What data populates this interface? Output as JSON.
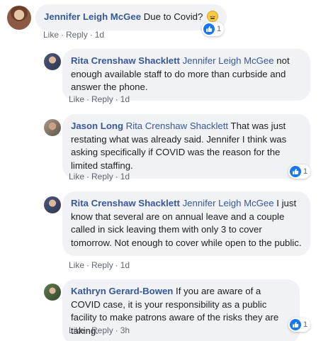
{
  "comments": [
    {
      "author": "Jennifer Leigh McGee",
      "mention": "",
      "text": "Due to Covid?",
      "emoji": "grimace-emoji",
      "actions": {
        "like": "Like",
        "reply": "Reply",
        "time": "1d",
        "dot": "·"
      },
      "reactions": {
        "count": "1",
        "icon": "like-icon"
      }
    },
    {
      "author": "Rita Crenshaw Shacklett",
      "mention": "Jennifer Leigh McGee",
      "text": "not enough available staff to do more than curbside and answer the phone.",
      "actions": {
        "like": "Like",
        "reply": "Reply",
        "time": "1d",
        "dot": "·"
      }
    },
    {
      "author": "Jason Long",
      "mention": "Rita Crenshaw Shacklett",
      "text": "That was just restating what was already said. Jennifer I think was asking specifically if COVID was the reason for the limited staffing.",
      "actions": {
        "like": "Like",
        "reply": "Reply",
        "time": "1d",
        "dot": "·"
      },
      "reactions": {
        "count": "1",
        "icon": "like-icon"
      }
    },
    {
      "author": "Rita Crenshaw Shacklett",
      "mention": "Jennifer Leigh McGee",
      "text": "I just know that several are on annual leave and a couple called in sick leaving them with only 3 to cover tomorrow. Not enough to cover while open to the public.",
      "actions": {
        "like": "Like",
        "reply": "Reply",
        "time": "1d",
        "dot": "·"
      }
    },
    {
      "author": "Kathryn Gerard-Bowen",
      "mention": "",
      "text": "If you are aware of a COVID case, it is your responsibility as a public facility to make patrons aware of the risks they are taking.",
      "actions": {
        "like": "Like",
        "reply": "Reply",
        "time": "3h",
        "dot": "·"
      },
      "reactions": {
        "count": "1",
        "icon": "like-icon"
      }
    }
  ],
  "colors": {
    "author": "#385898",
    "bubble": "#f0f2f5",
    "like": "#1877f2",
    "meta": "#606770"
  }
}
